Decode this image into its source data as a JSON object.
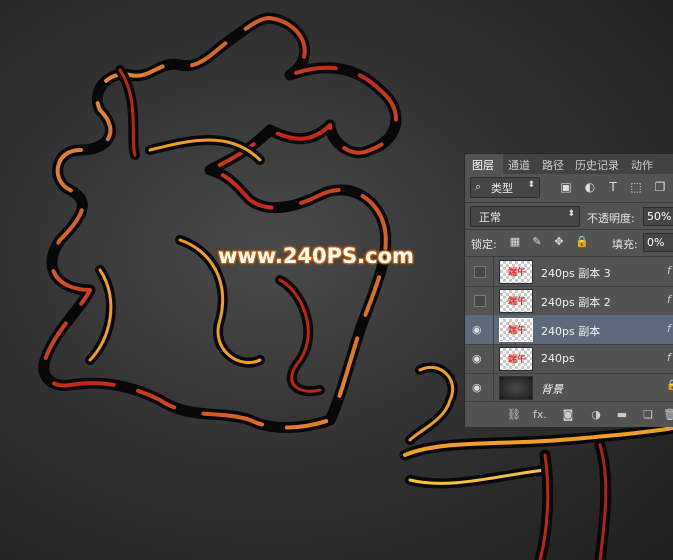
{
  "watermark": "www.240PS.com",
  "panel": {
    "tabs": [
      {
        "label": "图层",
        "active": true
      },
      {
        "label": "通道",
        "active": false
      },
      {
        "label": "路径",
        "active": false
      },
      {
        "label": "历史记录",
        "active": false
      },
      {
        "label": "动作",
        "active": false
      }
    ],
    "filter": {
      "label": "类型",
      "icons": [
        "image-filter-icon",
        "adjustment-filter-icon",
        "type-filter-icon",
        "shape-filter-icon",
        "smart-object-filter-icon"
      ]
    },
    "blend_mode": "正常",
    "opacity_label": "不透明度:",
    "opacity_value": "50%",
    "lock_label": "锁定:",
    "fill_label": "填充:",
    "fill_value": "0%",
    "layers": [
      {
        "name": "240ps 副本 3",
        "visible": false,
        "selected": false,
        "fx": "f",
        "thumb": "text"
      },
      {
        "name": "240ps 副本 2",
        "visible": false,
        "selected": false,
        "fx": "f",
        "thumb": "text"
      },
      {
        "name": "240ps 副本",
        "visible": true,
        "selected": true,
        "fx": "f",
        "thumb": "text"
      },
      {
        "name": "240ps",
        "visible": true,
        "selected": false,
        "fx": "f",
        "thumb": "text"
      },
      {
        "name": "背景",
        "visible": true,
        "selected": false,
        "fx": "",
        "thumb": "dark",
        "locked": true
      }
    ],
    "bottom_icons": [
      "link-icon",
      "fx-icon",
      "mask-icon",
      "adjustment-icon",
      "folder-icon",
      "new-layer-icon",
      "trash-icon"
    ],
    "fx_text": "fx."
  },
  "colors": {
    "background": "#333333",
    "panel": "#535353",
    "selected_layer": "#5d6a7c",
    "glow_orange": "#f0a020",
    "glow_red": "#b02020"
  }
}
